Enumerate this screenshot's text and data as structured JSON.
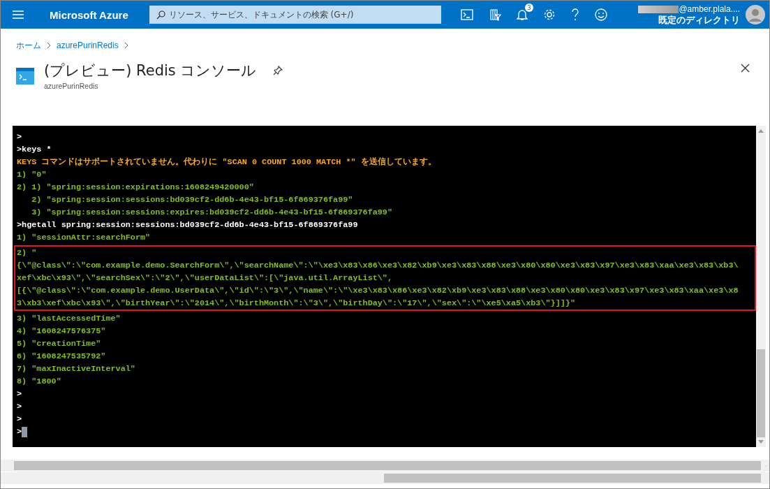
{
  "topbar": {
    "brand": "Microsoft Azure",
    "search": {
      "placeholder": "リソース、サービス、ドキュメントの検索 (G+/)"
    },
    "notification_count": "3",
    "account": {
      "email": "@amber.plala....",
      "directory": "既定のディレクトリ"
    }
  },
  "breadcrumb": [
    "ホーム",
    "azurePurinRedis"
  ],
  "header": {
    "title": "(プレビュー) Redis コンソール",
    "subtitle": "azurePurinRedis"
  },
  "console": {
    "blocks": [
      {
        "highlighted": false,
        "lines": [
          {
            "kind": "prompt",
            "text": ">"
          },
          {
            "kind": "prompt",
            "text": ">keys *"
          },
          {
            "kind": "warning",
            "text": "KEYS コマンドはサポートされていません。代わりに \"SCAN 0 COUNT 1000 MATCH *\" を送信しています。"
          },
          {
            "kind": "output",
            "text": "1) \"0\""
          },
          {
            "kind": "output",
            "text": "2) 1) \"spring:session:expirations:1608249420000\""
          },
          {
            "kind": "output",
            "text": "   2) \"spring:session:sessions:bd039cf2-dd6b-4e43-bf15-6f869376fa99\""
          },
          {
            "kind": "output",
            "text": "   3) \"spring:session:sessions:expires:bd039cf2-dd6b-4e43-bf15-6f869376fa99\""
          },
          {
            "kind": "prompt",
            "text": ">hgetall spring:session:sessions:bd039cf2-dd6b-4e43-bf15-6f869376fa99"
          },
          {
            "kind": "output",
            "text": "1) \"sessionAttr:searchForm\""
          }
        ]
      },
      {
        "highlighted": true,
        "lines": [
          {
            "kind": "output",
            "text": "2) \""
          },
          {
            "kind": "output",
            "text": "{\\\"@class\\\":\\\"com.example.demo.SearchForm\\\",\\\"searchName\\\":\\\"\\xe3\\x83\\x86\\xe3\\x82\\xb9\\xe3\\x83\\x88\\xe3\\x80\\x80\\xe3\\x83\\x97\\xe3\\x83\\xaa\\xe3\\x83\\xb3\\"
          },
          {
            "kind": "output",
            "text": "xef\\xbc\\x93\\\",\\\"searchSex\\\":\\\"2\\\",\\\"userDataList\\\":[\\\"java.util.ArrayList\\\","
          },
          {
            "kind": "output",
            "text": "[{\\\"@class\\\":\\\"com.example.demo.UserData\\\",\\\"id\\\":\\\"3\\\",\\\"name\\\":\\\"\\xe3\\x83\\x86\\xe3\\x82\\xb9\\xe3\\x83\\x88\\xe3\\x80\\x80\\xe3\\x83\\x97\\xe3\\x83\\xaa\\xe3\\x8"
          },
          {
            "kind": "output",
            "text": "3\\xb3\\xef\\xbc\\x93\\\",\\\"birthYear\\\":\\\"2014\\\",\\\"birthMonth\\\":\\\"3\\\",\\\"birthDay\\\":\\\"17\\\",\\\"sex\\\":\\\"\\xe5\\xa5\\xb3\\\"}]]}\""
          }
        ]
      },
      {
        "highlighted": false,
        "lines": [
          {
            "kind": "output",
            "text": "3) \"lastAccessedTime\""
          },
          {
            "kind": "output",
            "text": "4) \"1608247576375\""
          },
          {
            "kind": "output",
            "text": "5) \"creationTime\""
          },
          {
            "kind": "output",
            "text": "6) \"1608247535792\""
          },
          {
            "kind": "output",
            "text": "7) \"maxInactiveInterval\""
          },
          {
            "kind": "output",
            "text": "8) \"1800\""
          },
          {
            "kind": "prompt",
            "text": ">"
          },
          {
            "kind": "prompt",
            "text": ">"
          },
          {
            "kind": "prompt",
            "text": ">"
          },
          {
            "kind": "input",
            "text": ">"
          }
        ]
      }
    ]
  }
}
